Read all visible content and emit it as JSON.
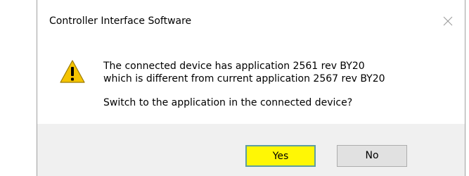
{
  "dialog": {
    "title": "Controller Interface Software",
    "message_line1": "The connected device has application 2561 rev BY20",
    "message_line2": "which is different from current application 2567 rev BY20",
    "question": "Switch to the application in the connected device?",
    "icon": "warning-icon",
    "close_icon": "close-icon"
  },
  "buttons": {
    "yes_label": "Yes",
    "no_label": "No"
  },
  "colors": {
    "yes_highlight": "#fff705",
    "footer_bg": "#f0f0f0",
    "warning_yellow": "#f5c400"
  }
}
